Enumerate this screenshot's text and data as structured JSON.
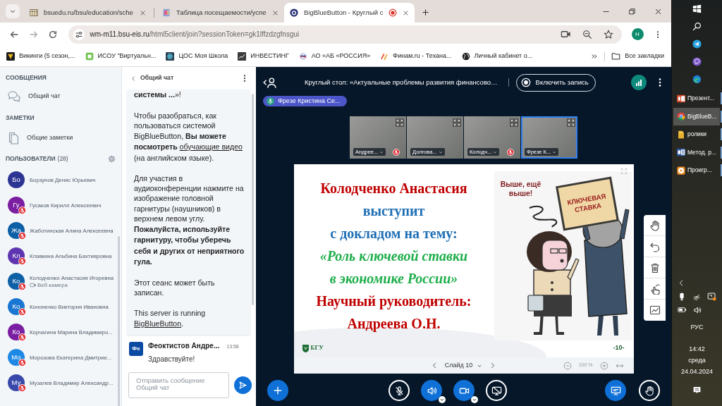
{
  "browser": {
    "tabs": [
      {
        "title": "bsuedu.ru/bsu/education/sche",
        "kind": "schedule",
        "selected": false,
        "recording": false
      },
      {
        "title": "Таблица посещаемости/успе",
        "kind": "sheet",
        "selected": false,
        "recording": false
      },
      {
        "title": "BigBlueButton - Круглый с",
        "kind": "meeting",
        "selected": true,
        "recording": true
      }
    ],
    "address": {
      "host": "wm-m11.bsu-eis.ru",
      "path": "/html5client/join?sessionToken=gk1lffzdzgfnsgui"
    },
    "profile": "H",
    "bookmarks": [
      {
        "label": "Викинги (5 сезон,...",
        "kind": "series"
      },
      {
        "label": "ИСОУ \"Виртуальн...",
        "kind": "portal"
      },
      {
        "label": "ЦОС Моя Школа",
        "kind": "atom"
      },
      {
        "label": "ИНВЕСТИНГ",
        "kind": "invest"
      },
      {
        "label": "АО «АБ «РОССИЯ»",
        "kind": "bank"
      },
      {
        "label": "Финам.ru - Техана...",
        "kind": "finam"
      },
      {
        "label": "Личный кабинет о...",
        "kind": "globe"
      }
    ],
    "all_bookmarks": "Все закладки"
  },
  "users_panel": {
    "sections": [
      {
        "title": "СООБЩЕНИЯ",
        "items": [
          {
            "label": "Общий чат",
            "kind": "chat"
          }
        ]
      },
      {
        "title": "ЗАМЕТКИ",
        "items": [
          {
            "label": "Общие заметки",
            "kind": "notes"
          }
        ]
      }
    ],
    "users_title": "ПОЛЬЗОВАТЕЛИ",
    "users_count": "(28)",
    "users": [
      {
        "initials": "Бо",
        "name": "Борзунов Денис Юрьевич",
        "color": "#2c3593",
        "muted": false
      },
      {
        "initials": "Гу",
        "name": "Гусаков Кирилл Алексеевич",
        "color": "#7b1fa2",
        "muted": true
      },
      {
        "initials": "Жа",
        "name": "Жаботинская Алина Алексеевна",
        "color": "#0d5fa6",
        "muted": true
      },
      {
        "initials": "Кл",
        "name": "Клавкина Альбина Бахтияровна",
        "color": "#5e35b1",
        "muted": true
      },
      {
        "initials": "Ко",
        "name": "Колодченко Анастасия Игоревна",
        "color": "#0d5fa6",
        "muted": true,
        "webcam": "Веб-камера"
      },
      {
        "initials": "Ко",
        "name": "Кононенко Виктория Ивановна",
        "color": "#1976d2",
        "muted": true
      },
      {
        "initials": "Ко",
        "name": "Корчагина Марина Владимиро...",
        "color": "#7b1fa2",
        "muted": true
      },
      {
        "initials": "Мо",
        "name": "Морозова Екатерина Дмитрие...",
        "color": "#1e88e5",
        "muted": true
      },
      {
        "initials": "Му",
        "name": "Музалев Владимир Александр...",
        "color": "#3949ab",
        "muted": true
      }
    ]
  },
  "chat": {
    "title": "Общий чат",
    "welcome": [
      {
        "text": "**системы ...**»!"
      },
      {
        "text": "Чтобы разобраться, как пользоваться системой BigBlueButton, **Вы можете посмотреть** ",
        "link": "обучающие видео",
        "after": " (на английском языке)."
      },
      {
        "text": "Для участия в аудиоконференции нажмите на изображение головной гарнитуры (наушников) в верхнем левом углу. **Пожалуйста, используйте гарнитуру, чтобы уберечь себя и других от неприятного гула.**"
      },
      {
        "text": "Этот сеанс может быть записан."
      },
      {
        "text": "This server is running ",
        "link": "BigBlueButton",
        "after": "."
      }
    ],
    "messages": [
      {
        "initials": "Фе",
        "author": "Феоктистов Андре...",
        "time": "13:58",
        "text": "Здравствуйте!"
      }
    ],
    "input": {
      "placeholder": "Отправить сообщение Общий чат"
    }
  },
  "meeting": {
    "title": "Круглый стол: «Актуальные проблемы развития финансово…",
    "record": {
      "label": "Включить запись",
      "recording": false
    },
    "talking": {
      "name": "Фрезе Кристина Се..."
    },
    "videos": [
      {
        "name": "Андрее...",
        "muted": true,
        "talking": false
      },
      {
        "name": "Долгова...",
        "muted": false,
        "talking": false
      },
      {
        "name": "Колодч...",
        "muted": true,
        "talking": false
      },
      {
        "name": "Фрезе К...",
        "muted": false,
        "talking": true
      }
    ],
    "slide": {
      "lines": [
        {
          "text": "Колодченко Анастасия",
          "color": "#c00000",
          "italic": false
        },
        {
          "text": "выступит",
          "color": "#1f6fb5",
          "italic": false
        },
        {
          "text": "с докладом на тему:",
          "color": "#1f6fb5",
          "italic": false
        },
        {
          "text": "«Роль ключевой ставки",
          "color": "#1fae4b",
          "italic": true
        },
        {
          "text": "в экономике России»",
          "color": "#1fae4b",
          "italic": true
        },
        {
          "text": "Научный руководитель:",
          "color": "#c00000",
          "italic": false
        },
        {
          "text": "Андреева О.Н.",
          "color": "#c00000",
          "italic": false
        }
      ],
      "illustration": {
        "speech": "Выше, ещё выше!",
        "sign": "КЛЮЧЕВАЯ СТАВКА"
      },
      "logo": "БГУ",
      "number": "-10-",
      "toolbar": {
        "label": "Слайд 10",
        "zoom": "100 %"
      }
    },
    "media_controls": [
      {
        "kind": "mic",
        "on": false
      },
      {
        "kind": "audio",
        "on": true
      },
      {
        "kind": "camera",
        "on": true
      },
      {
        "kind": "screen",
        "on": false
      }
    ],
    "view_controls": [
      {
        "kind": "presentation",
        "on": true
      },
      {
        "kind": "hand",
        "on": false
      }
    ]
  },
  "taskbar": {
    "apps": [
      {
        "label": "Презент...",
        "kind": "slides",
        "selected": false
      },
      {
        "label": "BigBlueB...",
        "kind": "browser",
        "selected": true
      },
      {
        "label": "ролики",
        "kind": "folder",
        "selected": false
      },
      {
        "label": "Метод. р...",
        "kind": "document",
        "selected": false
      },
      {
        "label": "Проигр...",
        "kind": "player",
        "selected": false
      }
    ],
    "tray": {
      "language": "РУС",
      "time": "14:42",
      "day": "среда",
      "date": "24.04.2024"
    }
  }
}
